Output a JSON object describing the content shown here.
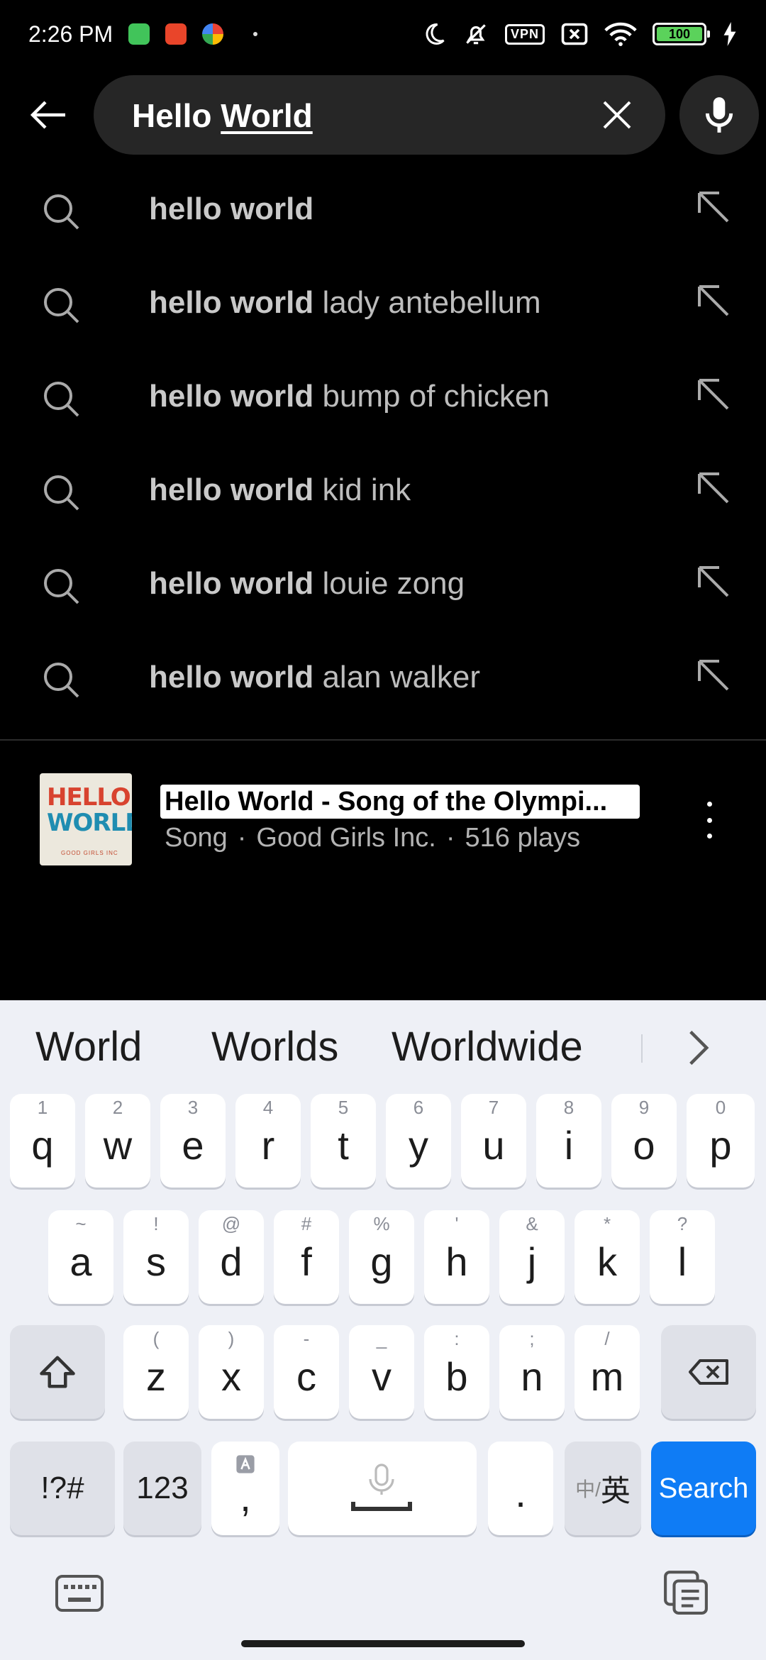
{
  "status_bar": {
    "time": "2:26 PM",
    "vpn_label": "VPN",
    "battery": "100",
    "icons": [
      "android-app-icon",
      "red-app-icon",
      "colorful-app-icon",
      "dot-icon",
      "moon-icon",
      "bell-muted-icon",
      "vpn-icon",
      "sim-x-icon",
      "wifi-icon",
      "battery-icon",
      "charging-icon"
    ]
  },
  "search": {
    "query_plain": "Hello ",
    "query_underlined": "World"
  },
  "suggestions": [
    {
      "bold": "hello world",
      "rest": ""
    },
    {
      "bold": "hello world",
      "rest": " lady antebellum"
    },
    {
      "bold": "hello world",
      "rest": " bump of chicken"
    },
    {
      "bold": "hello world",
      "rest": " kid ink"
    },
    {
      "bold": "hello world",
      "rest": " louie zong"
    },
    {
      "bold": "hello world",
      "rest": " alan walker"
    }
  ],
  "result": {
    "title": "Hello World - Song of the Olympi...",
    "type": "Song",
    "artist": "Good Girls Inc.",
    "plays": "516 plays",
    "separator": "·",
    "thumb_line1": "HELLO",
    "thumb_line2": "WORLD",
    "thumb_line3": "GOOD GIRLS INC"
  },
  "keyboard": {
    "predictions": [
      "World",
      "Worlds",
      "Worldwide"
    ],
    "row1": [
      {
        "k": "q",
        "h": "1"
      },
      {
        "k": "w",
        "h": "2"
      },
      {
        "k": "e",
        "h": "3"
      },
      {
        "k": "r",
        "h": "4"
      },
      {
        "k": "t",
        "h": "5"
      },
      {
        "k": "y",
        "h": "6"
      },
      {
        "k": "u",
        "h": "7"
      },
      {
        "k": "i",
        "h": "8"
      },
      {
        "k": "o",
        "h": "9"
      },
      {
        "k": "p",
        "h": "0"
      }
    ],
    "row2": [
      {
        "k": "a",
        "h": "~"
      },
      {
        "k": "s",
        "h": "!"
      },
      {
        "k": "d",
        "h": "@"
      },
      {
        "k": "f",
        "h": "#"
      },
      {
        "k": "g",
        "h": "%"
      },
      {
        "k": "h",
        "h": "'"
      },
      {
        "k": "j",
        "h": "&"
      },
      {
        "k": "k",
        "h": "*"
      },
      {
        "k": "l",
        "h": "?"
      }
    ],
    "row3": [
      {
        "k": "z",
        "h": "("
      },
      {
        "k": "x",
        "h": ")"
      },
      {
        "k": "c",
        "h": "-"
      },
      {
        "k": "v",
        "h": "_"
      },
      {
        "k": "b",
        "h": ":"
      },
      {
        "k": "n",
        "h": ";"
      },
      {
        "k": "m",
        "h": "/"
      }
    ],
    "symbols_label": "!?#",
    "numbers_label": "123",
    "comma_label": ",",
    "period_label": ".",
    "lang_label_small": "中/",
    "lang_label_big": "英",
    "search_label": "Search",
    "accent_color": "#0f7cf5"
  }
}
